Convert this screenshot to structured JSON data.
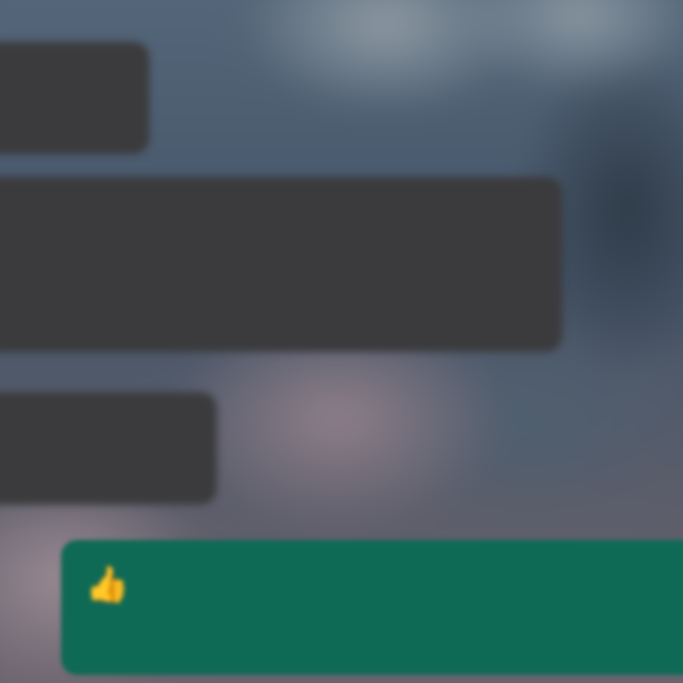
{
  "chat": {
    "messages": [
      {
        "id": "msg-1",
        "direction": "incoming",
        "sender": "",
        "sender_color": "#8fb92a",
        "text": "",
        "time": ""
      },
      {
        "id": "msg-2",
        "direction": "incoming",
        "sender": "",
        "text": "",
        "time": ""
      },
      {
        "id": "msg-3",
        "direction": "incoming",
        "sender": "",
        "sender_color": "#a874c8",
        "text": "",
        "time": ""
      },
      {
        "id": "msg-4",
        "direction": "outgoing",
        "text": "",
        "emoji": "👍",
        "time": ""
      }
    ]
  },
  "colors": {
    "incoming_bubble": "#3b3b3d",
    "outgoing_bubble": "#0f6a55",
    "wallpaper": "#4a5a6c"
  }
}
